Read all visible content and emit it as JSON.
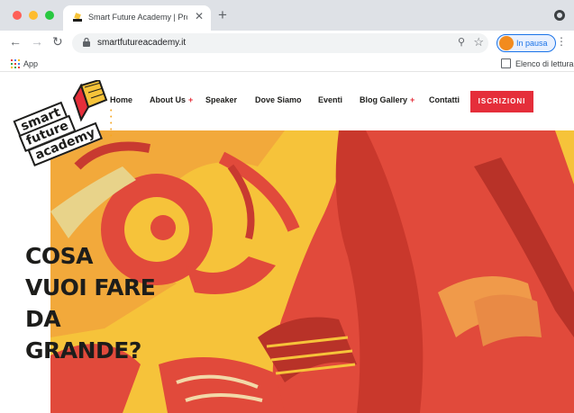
{
  "browser": {
    "tab_title": "Smart Future Academy | Progr",
    "new_tab": "+",
    "url": "smartfutureacademy.it",
    "pause_label": "In pausa",
    "bookmarks": {
      "apps_label": "App",
      "reading_list_label": "Elenco di lettura"
    },
    "icons": [
      "close-icon",
      "back-icon",
      "forward-icon",
      "reload-icon",
      "lock-icon",
      "zoom-icon",
      "star-icon",
      "menu-kebab-icon",
      "apps-grid-icon",
      "reading-list-icon"
    ]
  },
  "site": {
    "logo_words": [
      "smart",
      "future",
      "academy"
    ],
    "nav": [
      {
        "label": "Home",
        "has_plus": false
      },
      {
        "label": "About Us",
        "has_plus": true
      },
      {
        "label": "Speaker",
        "has_plus": false
      },
      {
        "label": "Dove Siamo",
        "has_plus": false
      },
      {
        "label": "Eventi",
        "has_plus": false
      },
      {
        "label": "Blog Gallery",
        "has_plus": true
      },
      {
        "label": "Contatti",
        "has_plus": false
      }
    ],
    "plus_symbol": "+",
    "home_indicator": "• • • • •",
    "cta_label": "ISCRIZIONI",
    "headline": [
      "COSA",
      "VUOI FARE",
      "DA",
      "GRANDE?"
    ],
    "colors": {
      "accent_red": "#e52e3a",
      "hero_yellow": "#f6c33a",
      "hero_red": "#e14a3b",
      "text_dark": "#1d1d1b"
    }
  }
}
